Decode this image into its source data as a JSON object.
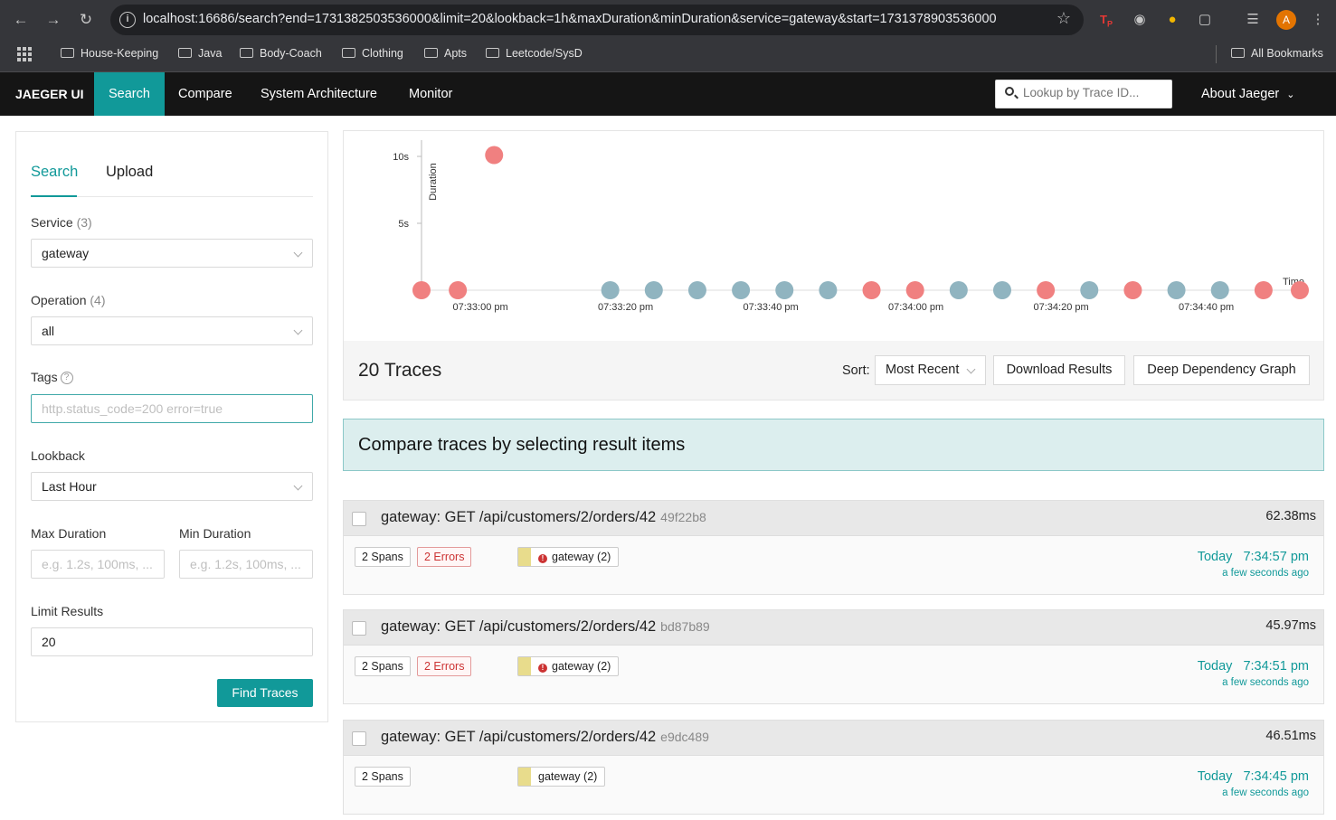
{
  "browser": {
    "url": "localhost:16686/search?end=1731382503536000&limit=20&lookback=1h&maxDuration&minDuration&service=gateway&start=1731378903536000",
    "avatar_letter": "A",
    "bookmarks": [
      "House-Keeping",
      "Java",
      "Body-Coach",
      "Clothing",
      "Apts",
      "Leetcode/SysD"
    ],
    "all_bookmarks": "All Bookmarks"
  },
  "nav": {
    "brand": "JAEGER UI",
    "items": [
      "Search",
      "Compare",
      "System Architecture",
      "Monitor"
    ],
    "lookup_placeholder": "Lookup by Trace ID...",
    "about": "About Jaeger"
  },
  "form": {
    "tabs": [
      "Search",
      "Upload"
    ],
    "service_label": "Service",
    "service_count": "(3)",
    "service_value": "gateway",
    "operation_label": "Operation",
    "operation_count": "(4)",
    "operation_value": "all",
    "tags_label": "Tags",
    "tags_placeholder": "http.status_code=200 error=true",
    "lookback_label": "Lookback",
    "lookback_value": "Last Hour",
    "max_duration_label": "Max Duration",
    "min_duration_label": "Min Duration",
    "duration_placeholder": "e.g. 1.2s, 100ms, ...",
    "limit_label": "Limit Results",
    "limit_value": "20",
    "find_button": "Find Traces"
  },
  "chart_data": {
    "type": "scatter",
    "xlabel": "Time",
    "ylabel": "Duration",
    "y_ticks": [
      "5s",
      "10s"
    ],
    "x_ticks": [
      "07:33:00 pm",
      "07:33:20 pm",
      "07:33:40 pm",
      "07:34:00 pm",
      "07:34:20 pm",
      "07:34:40 pm"
    ],
    "ylim": [
      0,
      11
    ],
    "error_color": "#f08080",
    "ok_color": "#90b4c0",
    "points": [
      {
        "t": "07:32:56 pm",
        "duration_s": 0.06,
        "error": true
      },
      {
        "t": "07:33:01 pm",
        "duration_s": 0.06,
        "error": true
      },
      {
        "t": "07:33:06 pm",
        "duration_s": 10.1,
        "error": true
      },
      {
        "t": "07:33:22 pm",
        "duration_s": 0.05,
        "error": false
      },
      {
        "t": "07:33:28 pm",
        "duration_s": 0.05,
        "error": false
      },
      {
        "t": "07:33:34 pm",
        "duration_s": 0.05,
        "error": false
      },
      {
        "t": "07:33:40 pm",
        "duration_s": 0.05,
        "error": false
      },
      {
        "t": "07:33:46 pm",
        "duration_s": 0.05,
        "error": false
      },
      {
        "t": "07:33:52 pm",
        "duration_s": 0.05,
        "error": false
      },
      {
        "t": "07:33:58 pm",
        "duration_s": 0.05,
        "error": true
      },
      {
        "t": "07:34:04 pm",
        "duration_s": 0.05,
        "error": true
      },
      {
        "t": "07:34:10 pm",
        "duration_s": 0.05,
        "error": false
      },
      {
        "t": "07:34:16 pm",
        "duration_s": 0.05,
        "error": false
      },
      {
        "t": "07:34:22 pm",
        "duration_s": 0.05,
        "error": true
      },
      {
        "t": "07:34:28 pm",
        "duration_s": 0.05,
        "error": false
      },
      {
        "t": "07:34:34 pm",
        "duration_s": 0.05,
        "error": true
      },
      {
        "t": "07:34:40 pm",
        "duration_s": 0.05,
        "error": false
      },
      {
        "t": "07:34:46 pm",
        "duration_s": 0.05,
        "error": false
      },
      {
        "t": "07:34:52 pm",
        "duration_s": 0.05,
        "error": true
      },
      {
        "t": "07:34:57 pm",
        "duration_s": 0.06,
        "error": true
      }
    ]
  },
  "results": {
    "count_label": "20 Traces",
    "sort_label": "Sort:",
    "sort_value": "Most Recent",
    "download_button": "Download Results",
    "ddg_button": "Deep Dependency Graph",
    "compare_banner": "Compare traces by selecting result items"
  },
  "traces": [
    {
      "title": "gateway: GET /api/customers/2/orders/42",
      "id": "49f22b8",
      "duration": "62.38ms",
      "spans": "2 Spans",
      "errors": "2 Errors",
      "service": "gateway (2)",
      "day": "Today",
      "time": "7:34:57 pm",
      "ago": "a few seconds ago"
    },
    {
      "title": "gateway: GET /api/customers/2/orders/42",
      "id": "bd87b89",
      "duration": "45.97ms",
      "spans": "2 Spans",
      "errors": "2 Errors",
      "service": "gateway (2)",
      "day": "Today",
      "time": "7:34:51 pm",
      "ago": "a few seconds ago"
    },
    {
      "title": "gateway: GET /api/customers/2/orders/42",
      "id": "e9dc489",
      "duration": "46.51ms",
      "spans": "2 Spans",
      "errors": "",
      "service": "gateway (2)",
      "day": "Today",
      "time": "7:34:45 pm",
      "ago": "a few seconds ago"
    }
  ]
}
